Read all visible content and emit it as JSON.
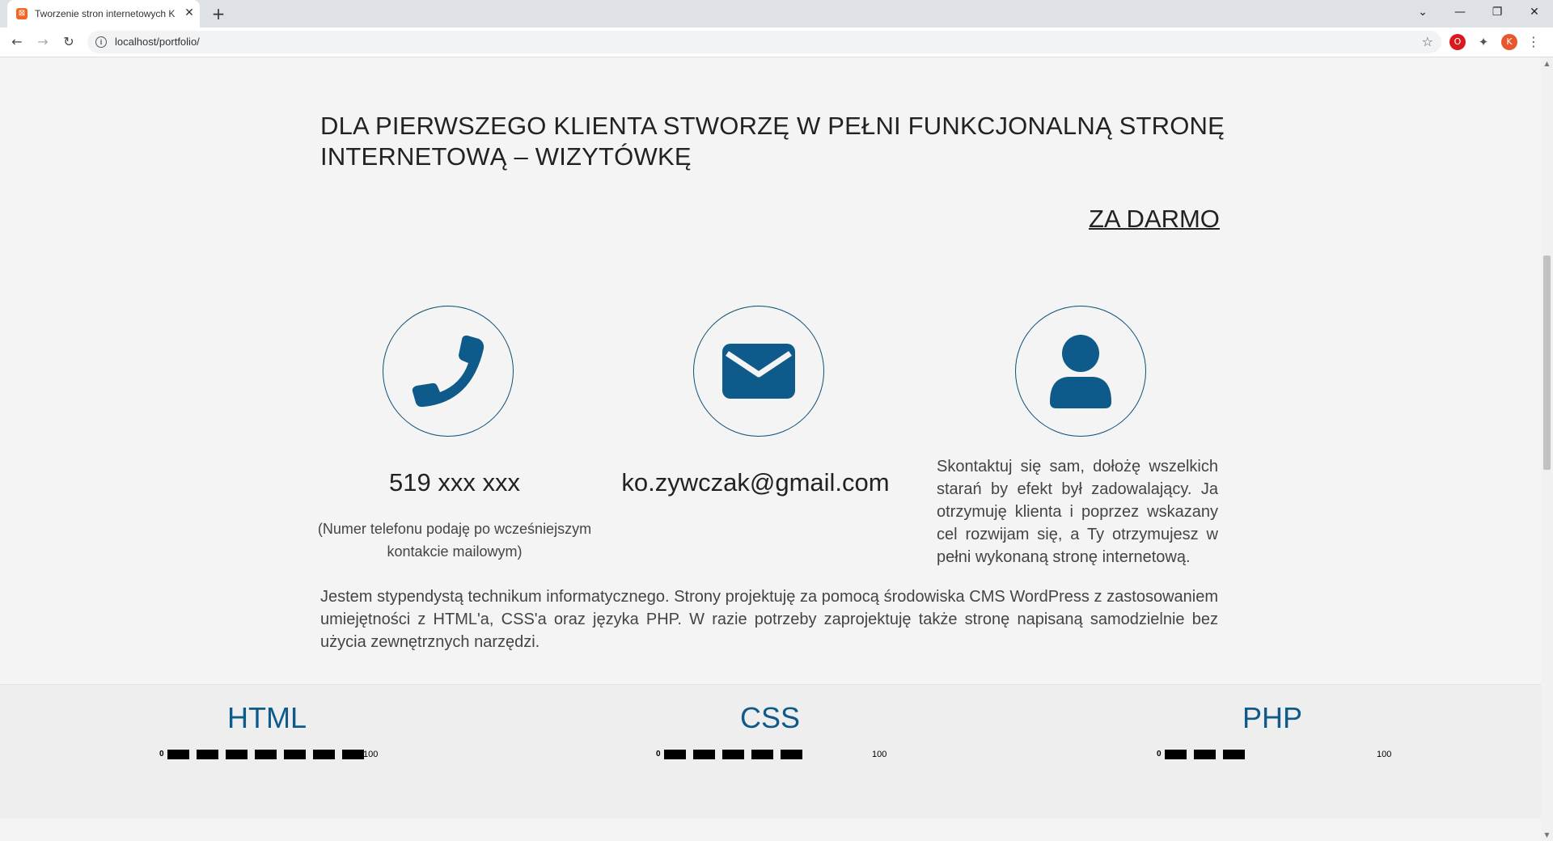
{
  "browser": {
    "tab_title": "Tworzenie stron internetowych K",
    "tab_close": "✕",
    "new_tab": "+",
    "url": "localhost/portfolio/",
    "profile_initial": "K",
    "controls": {
      "dropdown": "⌄",
      "minimize": "—",
      "restore": "❐",
      "close": "✕"
    },
    "nav": {
      "back": "←",
      "forward": "→",
      "reload": "↻"
    },
    "star": "☆"
  },
  "hero": {
    "headline": "DLA PIERWSZEGO KLIENTA STWORZĘ W PEŁNI FUNKCJONALNĄ STRONĘ INTERNETOWĄ – WIZYTÓWKĘ",
    "highlight": "ZA DARMO"
  },
  "contact": {
    "phone": "519 xxx xxx",
    "phone_note": "(Numer telefonu podaję po wcześniejszym kontakcie mailowym)",
    "email": "ko.zywczak@gmail.com",
    "description": "Skontaktuj się sam, dołożę wszelkich starań by efekt był zadowalający. Ja otrzymuję klienta i poprzez wskazany cel rozwijam się, a Ty otrzymujesz w pełni wykonaną stronę internetową.",
    "icons": [
      "phone-icon",
      "envelope-icon",
      "user-icon"
    ],
    "icon_color": "#0e5a8a"
  },
  "about": {
    "text": "Jestem stypendystą technikum informatycznego. Strony projektuję za pomocą środowiska CMS WordPress z zastosowaniem umiejętności z HTML'a, CSS'a oraz języka PHP. W razie potrzeby zaprojektuję także stronę napisaną samodzielnie bez użycia zewnętrznych narzędzi."
  },
  "skills": [
    {
      "name": "HTML",
      "min": "0",
      "max": "100",
      "filled_segments": 7
    },
    {
      "name": "CSS",
      "min": "0",
      "max": "100",
      "filled_segments": 5
    },
    {
      "name": "PHP",
      "min": "0",
      "max": "100",
      "filled_segments": 3
    }
  ]
}
